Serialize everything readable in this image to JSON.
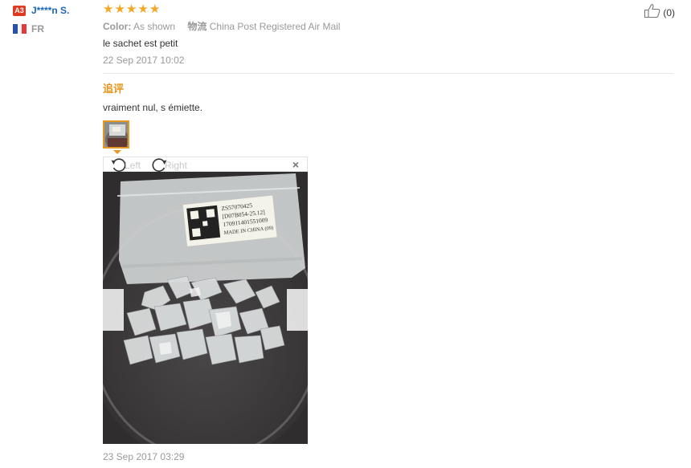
{
  "user": {
    "level_badge": "A3",
    "name": "J****n S.",
    "country": "FR"
  },
  "review": {
    "rating": 5,
    "stars": [
      "★",
      "★",
      "★",
      "★",
      "★"
    ],
    "helpful_count": "(0)",
    "attrs": {
      "color_label": "Color:",
      "color_value": "As shown",
      "shipping_label": "物流",
      "shipping_value": "China Post Registered Air Mail"
    },
    "text": "le sachet est petit",
    "date": "22 Sep 2017 10:02"
  },
  "followup": {
    "label": "追评",
    "text": "vraiment nul, s émiette.",
    "date": "23 Sep 2017 03:29"
  },
  "viewer": {
    "rotate_left_label": "Left",
    "rotate_right_label": "Right",
    "close_label": "×"
  },
  "photo_label": {
    "line1": "ZS57070425",
    "line2": "[D07B054-25.12]",
    "line3": "170911401551009",
    "line4": "MADE IN CHINA (09)"
  },
  "colors": {
    "accent": "#e5971f",
    "star": "#f5a623",
    "link": "#1a67b8",
    "badge": "#e0371f"
  }
}
